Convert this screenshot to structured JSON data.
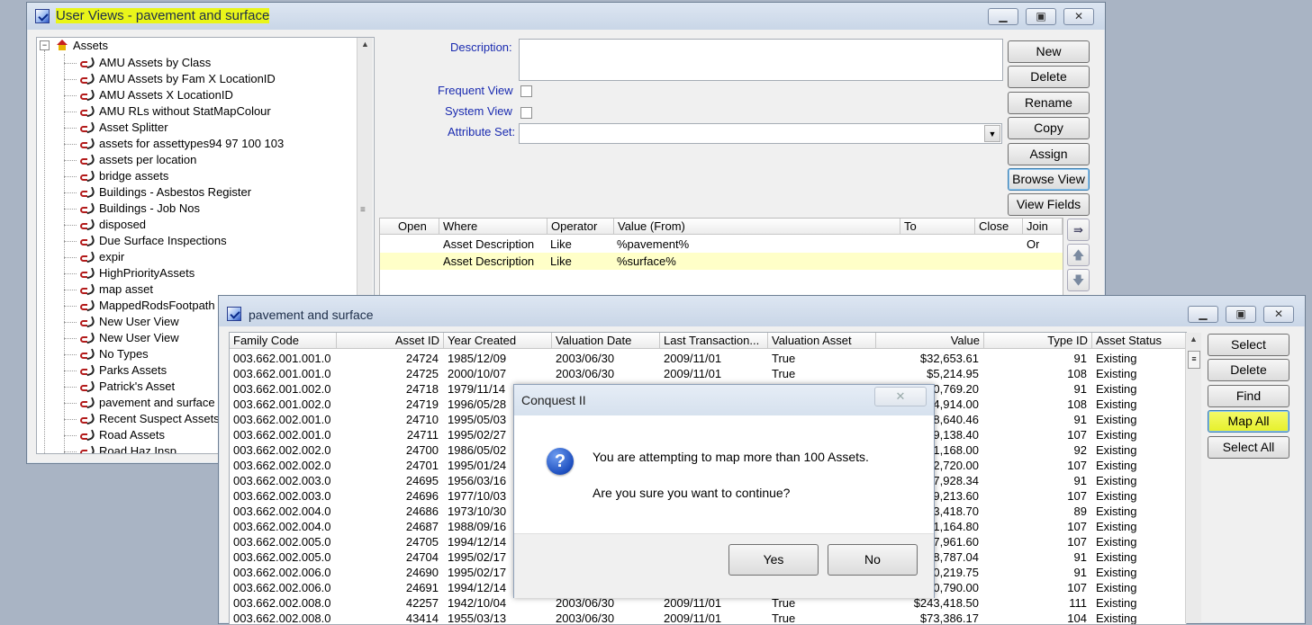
{
  "colors": {
    "highlight": "#e9f51a",
    "row_selected": "#ffffc8"
  },
  "main_window": {
    "title": "User Views - pavement and surface",
    "tree": {
      "root": "Assets",
      "items": [
        "AMU Assets by Class",
        "AMU Assets by Fam X LocationID",
        "AMU Assets X LocationID",
        "AMU RLs without StatMapColour",
        "Asset Splitter",
        "assets for assettypes94 97 100 103",
        "assets per location",
        "bridge assets",
        "Buildings - Asbestos Register",
        "Buildings - Job Nos",
        "disposed",
        "Due Surface Inspections",
        "expir",
        "HighPriorityAssets",
        "map asset",
        "MappedRodsFootpath",
        "New User View",
        "New User View",
        "No Types",
        "Parks Assets",
        "Patrick's Asset",
        "pavement and surface",
        "Recent Suspect Assets",
        "Road Assets",
        "Road Haz Insp"
      ]
    },
    "form": {
      "description_label": "Description:",
      "description_value": "",
      "frequent_label": "Frequent View",
      "system_label": "System View",
      "attribute_label": "Attribute Set:",
      "attribute_value": ""
    },
    "buttons": {
      "new": "New",
      "delete": "Delete",
      "rename": "Rename",
      "copy": "Copy",
      "assign": "Assign",
      "browse": "Browse View",
      "fields": "View Fields"
    },
    "criteria": {
      "headers": {
        "open": "Open",
        "where": "Where",
        "operator": "Operator",
        "value": "Value (From)",
        "to": "To",
        "close": "Close",
        "join": "Join"
      },
      "rows": [
        {
          "where": "Asset Description",
          "operator": "Like",
          "value": "%pavement%",
          "join": "Or"
        },
        {
          "where": "Asset Description",
          "operator": "Like",
          "value": "%surface%",
          "join": ""
        }
      ]
    }
  },
  "results_window": {
    "title": "pavement and surface",
    "headers": {
      "family": "Family Code",
      "asset_id": "Asset ID",
      "year": "Year Created",
      "valuation_date": "Valuation Date",
      "last_tx": "Last Transaction...",
      "valuation_asset": "Valuation Asset",
      "value": "Value",
      "type_id": "Type ID",
      "status": "Asset Status"
    },
    "rows": [
      {
        "family": "003.662.001.001.0...",
        "asset_id": "24724",
        "year": "1985/12/09",
        "vdate": "2003/06/30",
        "last": "2009/11/01",
        "vasset": "True",
        "value": "$32,653.61",
        "type": "91",
        "status": "Existing"
      },
      {
        "family": "003.662.001.001.0...",
        "asset_id": "24725",
        "year": "2000/10/07",
        "vdate": "2003/06/30",
        "last": "2009/11/01",
        "vasset": "True",
        "value": "$5,214.95",
        "type": "108",
        "status": "Existing"
      },
      {
        "family": "003.662.001.002.0...",
        "asset_id": "24718",
        "year": "1979/11/14",
        "vdate": "",
        "last": "",
        "vasset": "",
        "value": "30,769.20",
        "type": "91",
        "status": "Existing"
      },
      {
        "family": "003.662.001.002.0...",
        "asset_id": "24719",
        "year": "1996/05/28",
        "vdate": "",
        "last": "",
        "vasset": "",
        "value": "$4,914.00",
        "type": "108",
        "status": "Existing"
      },
      {
        "family": "003.662.002.001.0...",
        "asset_id": "24710",
        "year": "1995/05/03",
        "vdate": "",
        "last": "",
        "vasset": "",
        "value": "58,640.46",
        "type": "91",
        "status": "Existing"
      },
      {
        "family": "003.662.002.001.0...",
        "asset_id": "24711",
        "year": "1995/02/27",
        "vdate": "",
        "last": "",
        "vasset": "",
        "value": "09,138.40",
        "type": "107",
        "status": "Existing"
      },
      {
        "family": "003.662.002.002.0...",
        "asset_id": "24700",
        "year": "1986/05/02",
        "vdate": "",
        "last": "",
        "vasset": "",
        "value": "91,168.00",
        "type": "92",
        "status": "Existing"
      },
      {
        "family": "003.662.002.002.0...",
        "asset_id": "24701",
        "year": "1995/01/24",
        "vdate": "",
        "last": "",
        "vasset": "",
        "value": "62,720.00",
        "type": "107",
        "status": "Existing"
      },
      {
        "family": "003.662.002.003.0...",
        "asset_id": "24695",
        "year": "1956/03/16",
        "vdate": "",
        "last": "",
        "vasset": "",
        "value": "27,928.34",
        "type": "91",
        "status": "Existing"
      },
      {
        "family": "003.662.002.003.0...",
        "asset_id": "24696",
        "year": "1977/10/03",
        "vdate": "",
        "last": "",
        "vasset": "",
        "value": "19,213.60",
        "type": "107",
        "status": "Existing"
      },
      {
        "family": "003.662.002.004.0...",
        "asset_id": "24686",
        "year": "1973/10/30",
        "vdate": "",
        "last": "",
        "vasset": "",
        "value": "03,418.70",
        "type": "89",
        "status": "Existing"
      },
      {
        "family": "003.662.002.004.0...",
        "asset_id": "24687",
        "year": "1988/09/16",
        "vdate": "",
        "last": "",
        "vasset": "",
        "value": "71,164.80",
        "type": "107",
        "status": "Existing"
      },
      {
        "family": "003.662.002.005.0...",
        "asset_id": "24705",
        "year": "1994/12/14",
        "vdate": "",
        "last": "",
        "vasset": "",
        "value": "67,961.60",
        "type": "107",
        "status": "Existing"
      },
      {
        "family": "003.662.002.005.0...",
        "asset_id": "24704",
        "year": "1995/02/17",
        "vdate": "",
        "last": "",
        "vasset": "",
        "value": "98,787.04",
        "type": "91",
        "status": "Existing"
      },
      {
        "family": "003.662.002.006.0...",
        "asset_id": "24690",
        "year": "1995/02/17",
        "vdate": "",
        "last": "",
        "vasset": "",
        "value": "30,219.75",
        "type": "91",
        "status": "Existing"
      },
      {
        "family": "003.662.002.006.0...",
        "asset_id": "24691",
        "year": "1994/12/14",
        "vdate": "",
        "last": "",
        "vasset": "",
        "value": "20,790.00",
        "type": "107",
        "status": "Existing"
      },
      {
        "family": "003.662.002.008.0...",
        "asset_id": "42257",
        "year": "1942/10/04",
        "vdate": "2003/06/30",
        "last": "2009/11/01",
        "vasset": "True",
        "value": "$243,418.50",
        "type": "111",
        "status": "Existing"
      },
      {
        "family": "003.662.002.008.0...",
        "asset_id": "43414",
        "year": "1955/03/13",
        "vdate": "2003/06/30",
        "last": "2009/11/01",
        "vasset": "True",
        "value": "$73,386.17",
        "type": "104",
        "status": "Existing"
      }
    ],
    "buttons": {
      "select": "Select",
      "delete": "Delete",
      "find": "Find",
      "map_all": "Map All",
      "select_all": "Select All"
    }
  },
  "dialog": {
    "title": "Conquest II",
    "line1": "You are attempting to map more than 100 Assets.",
    "line2": "Are you sure you want to continue?",
    "yes": "Yes",
    "no": "No",
    "close": "✕",
    "icon": "question-icon"
  }
}
